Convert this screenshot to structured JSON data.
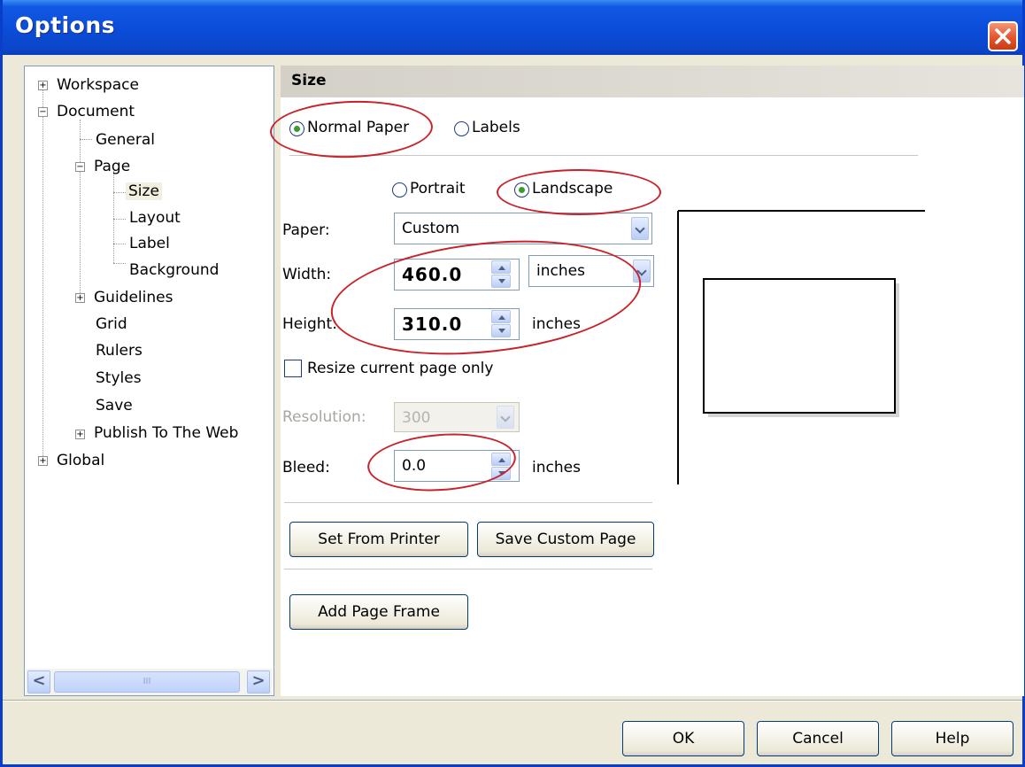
{
  "window": {
    "title": "Options"
  },
  "tree": {
    "items": [
      {
        "label": "Workspace",
        "expander": "+"
      },
      {
        "label": "Document",
        "expander": "−"
      },
      {
        "label": "General"
      },
      {
        "label": "Page",
        "expander": "−"
      },
      {
        "label": "Size",
        "selected": true
      },
      {
        "label": "Layout"
      },
      {
        "label": "Label"
      },
      {
        "label": "Background"
      },
      {
        "label": "Guidelines",
        "expander": "+"
      },
      {
        "label": "Grid"
      },
      {
        "label": "Rulers"
      },
      {
        "label": "Styles"
      },
      {
        "label": "Save"
      },
      {
        "label": "Publish To The Web",
        "expander": "+"
      },
      {
        "label": "Global",
        "expander": "+"
      }
    ],
    "scroll_left": "<",
    "scroll_right": ">",
    "scroll_grip": "III"
  },
  "panel": {
    "header": "Size",
    "paper_type": {
      "normal_label": "Normal Paper",
      "labels_label": "Labels",
      "selected": "Normal Paper"
    },
    "orientation": {
      "portrait_label": "Portrait",
      "landscape_label": "Landscape",
      "selected": "Landscape"
    },
    "paper": {
      "label": "Paper:",
      "value": "Custom"
    },
    "width": {
      "label": "Width:",
      "value": "460.0",
      "unit": "inches"
    },
    "height": {
      "label": "Height:",
      "value": "310.0",
      "unit": "inches"
    },
    "resize_current": {
      "label": "Resize current page only",
      "checked": false
    },
    "resolution": {
      "label": "Resolution:",
      "value": "300",
      "disabled": true
    },
    "bleed": {
      "label": "Bleed:",
      "value": "0.0",
      "unit": "inches"
    },
    "buttons": {
      "set_from_printer": "Set From Printer",
      "save_custom_page": "Save Custom Page",
      "add_page_frame": "Add Page Frame"
    }
  },
  "footer": {
    "ok": "OK",
    "cancel": "Cancel",
    "help": "Help"
  },
  "colors": {
    "title_bar": "#0a4cd8",
    "highlight_ellipse": "#c8232b",
    "dialog_bg": "#ece9d8"
  }
}
